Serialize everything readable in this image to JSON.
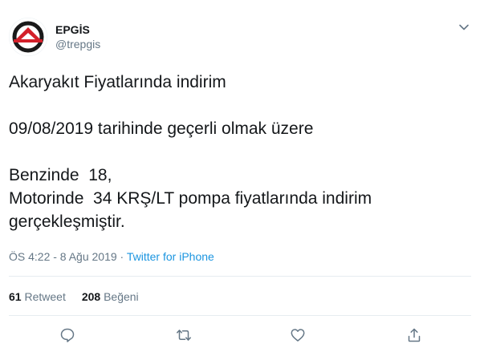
{
  "author": {
    "display_name": "EPGİS",
    "handle": "@trepgis"
  },
  "tweet": {
    "lines": [
      "Akaryakıt Fiyatlarında indirim",
      "",
      "09/08/2019 tarihinde geçerli olmak üzere",
      "",
      "Benzinde  18,",
      "Motorinde  34 KRŞ/LT pompa fiyatlarında indirim",
      "gerçekleşmiştir."
    ]
  },
  "meta": {
    "timestamp": "ÖS 4:22 - 8 Ağu 2019",
    "separator": " · ",
    "source": "Twitter for iPhone"
  },
  "stats": {
    "retweet_count": "61",
    "retweet_label": "Retweet",
    "like_count": "208",
    "like_label": "Beğeni"
  },
  "icons": {
    "caret": "chevron-down-icon",
    "reply": "reply-icon",
    "retweet": "retweet-icon",
    "like": "heart-icon",
    "share": "share-icon"
  },
  "colors": {
    "text": "#14171a",
    "secondary": "#657786",
    "link": "#1b95e0",
    "divider": "#e6ecf0",
    "logo_red": "#d3202a"
  }
}
